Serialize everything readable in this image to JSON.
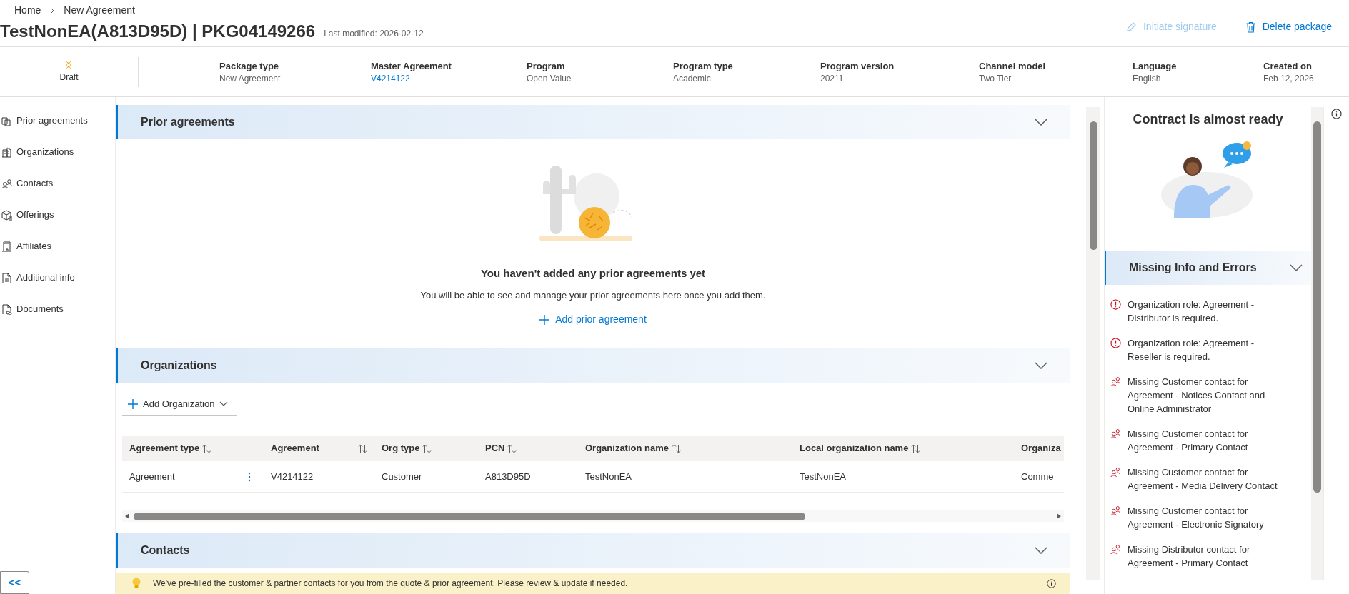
{
  "breadcrumb": [
    {
      "label": "Home"
    },
    {
      "label": "New Agreement"
    }
  ],
  "title": "TestNonEA(A813D95D) | PKG04149266",
  "last_modified": "Last modified: 2026-02-12",
  "actions": [
    {
      "label": "Initiate signature",
      "disabled": true
    },
    {
      "label": "Delete package",
      "disabled": false
    }
  ],
  "status": {
    "label": "Draft"
  },
  "details": [
    {
      "label": "Package type",
      "value": "New Agreement",
      "kind": "text"
    },
    {
      "label": "Master Agreement",
      "value": "V4214122",
      "kind": "link"
    },
    {
      "label": "Program",
      "value": "Open Value",
      "kind": "text"
    },
    {
      "label": "Program type",
      "value": "Academic",
      "kind": "text"
    },
    {
      "label": "Program version",
      "value": "20211",
      "kind": "text"
    },
    {
      "label": "Channel model",
      "value": "Two Tier",
      "kind": "text"
    },
    {
      "label": "Language",
      "value": "English",
      "kind": "text"
    },
    {
      "label": "Created on",
      "value": "Feb 12, 2026",
      "kind": "text"
    }
  ],
  "sidebar": {
    "items": [
      {
        "label": "Prior agreements"
      },
      {
        "label": "Organizations"
      },
      {
        "label": "Contacts"
      },
      {
        "label": "Offerings"
      },
      {
        "label": "Affiliates"
      },
      {
        "label": "Additional info"
      },
      {
        "label": "Documents"
      }
    ]
  },
  "prior_agreements": {
    "title": "Prior agreements",
    "expanded": true,
    "empty_title": "You haven't added any prior agreements yet",
    "empty_text": "You will be able to see and manage your prior agreements here once you add them.",
    "add_link": "Add prior agreement"
  },
  "organizations": {
    "title": "Organizations",
    "expanded": true,
    "add_button": "Add Organization",
    "table": {
      "columns": [
        {
          "label": "Agreement type",
          "sortable": true
        },
        {
          "label": "Agreement",
          "sortable": true
        },
        {
          "label": "Org type",
          "sortable": true
        },
        {
          "label": "PCN",
          "sortable": true
        },
        {
          "label": "Organization name",
          "sortable": true
        },
        {
          "label": "Local organization name",
          "sortable": true
        },
        {
          "label": "Organiza",
          "sortable": false
        }
      ],
      "rows": [
        {
          "actions_menu": true,
          "cells": [
            "Agreement",
            "V4214122",
            "Customer",
            "A813D95D",
            "TestNonEA",
            "TestNonEA",
            "Comme"
          ]
        }
      ]
    }
  },
  "contacts": {
    "title": "Contacts",
    "expanded": true,
    "notice": "We've pre-filled the customer & partner contacts for you from the quote & prior agreement. Please review & update if needed."
  },
  "readiness": {
    "title": "Contract is almost ready",
    "missing": {
      "title": "Missing Info and Errors",
      "expanded": true,
      "items": [
        {
          "kind": "error",
          "text": "Organization role: Agreement - Distributor is required."
        },
        {
          "kind": "error",
          "text": "Organization role: Agreement - Reseller is required."
        },
        {
          "kind": "contact",
          "text": "Missing Customer contact for Agreement - Notices Contact and Online Administrator"
        },
        {
          "kind": "contact",
          "text": "Missing Customer contact for Agreement - Primary Contact"
        },
        {
          "kind": "contact",
          "text": "Missing Customer contact for Agreement - Media Delivery Contact"
        },
        {
          "kind": "contact",
          "text": "Missing Customer contact for Agreement - Electronic Signatory"
        },
        {
          "kind": "contact",
          "text": "Missing Distributor contact for Agreement - Primary Contact"
        }
      ]
    }
  },
  "collapse_button": "<<"
}
